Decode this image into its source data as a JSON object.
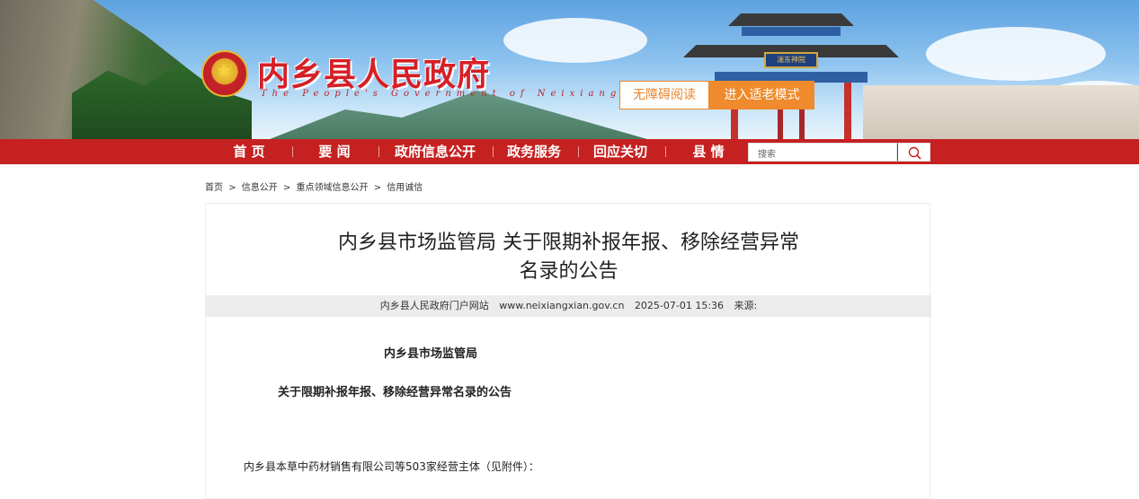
{
  "header": {
    "site_title": "内乡县人民政府",
    "site_subtitle": "The People's Government of Neixiang",
    "accessibility_button": "无障碍阅读",
    "elder_mode_button": "进入适老模式",
    "gate_plaque": "湍东神院"
  },
  "nav": {
    "items": [
      "首 页",
      "要 闻",
      "政府信息公开",
      "政务服务",
      "回应关切",
      "县 情"
    ],
    "search_placeholder": "搜索"
  },
  "breadcrumb": {
    "items": [
      "首页",
      "信息公开",
      "重点领域信息公开",
      "信用诚信"
    ],
    "separator": ">"
  },
  "article": {
    "title_line1": "内乡县市场监管局 关于限期补报年报、移除经营异常",
    "title_line2": "名录的公告",
    "meta": {
      "source_site": "内乡县人民政府门户网站",
      "url": "www.neixiangxian.gov.cn",
      "datetime": "2025-07-01 15:36",
      "source_label": "来源:"
    },
    "body_heading1": "内乡县市场监管局",
    "body_heading2": "关于限期补报年报、移除经营异常名录的公告",
    "body_paragraph1": "内乡县本草中药材销售有限公司等503家经营主体（见附件）："
  },
  "colors": {
    "nav_red": "#c62121",
    "title_red": "#d61f26",
    "elder_orange": "#ef8b2c"
  }
}
